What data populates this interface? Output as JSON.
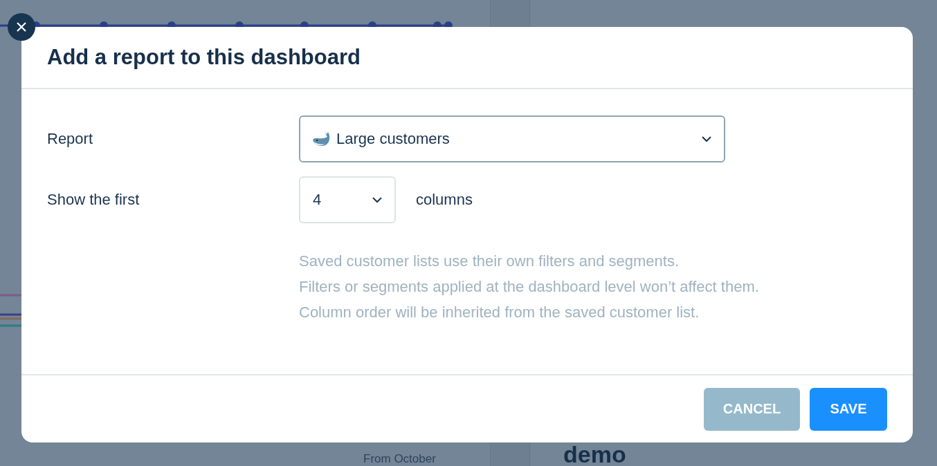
{
  "background": {
    "texts": [
      {
        "kind": "caption",
        "text": "From October"
      },
      {
        "kind": "value",
        "text": "demo"
      }
    ]
  },
  "dialog": {
    "title": "Add a report to this dashboard",
    "fields": [
      {
        "kind": "select",
        "label": "Report",
        "value": "Large customers"
      },
      {
        "kind": "number-select",
        "label": "Show the first",
        "value": "4",
        "suffix": "columns"
      }
    ],
    "help": [
      "Saved customer lists use their own filters and segments.",
      "Filters or segments applied at the dashboard level won’t affect them.",
      "Column order will be inherited from the saved customer list."
    ],
    "buttons": [
      {
        "kind": "secondary",
        "label": "CANCEL"
      },
      {
        "kind": "primary",
        "label": "SAVE"
      }
    ]
  }
}
